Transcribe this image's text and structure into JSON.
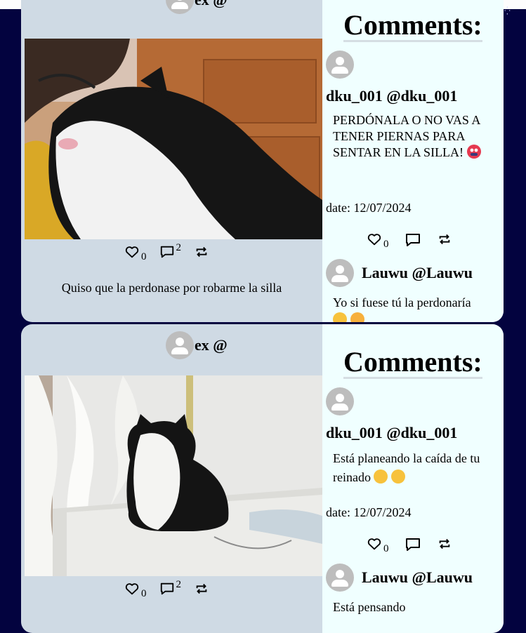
{
  "posts": [
    {
      "author": "ex @",
      "likes": "0",
      "comments_count": "2",
      "caption": "Quiso que la perdonase por robarme la silla",
      "comments_heading": "Comments:",
      "comments": [
        {
          "user": "dku_001 @dku_001",
          "text": "PERDÓNALA O NO VAS A TENER PIERNAS PARA SENTAR EN LA SILLA!",
          "emoji": "mask-mouth-emoji",
          "date": "date: 12/07/2024",
          "likes": "0"
        },
        {
          "user": "Lauwu @Lauwu",
          "text": "Yo si fuese tú la perdonaría",
          "emoji": "heart-eyes-emoji"
        }
      ]
    },
    {
      "author": "ex @",
      "likes": "0",
      "comments_count": "2",
      "comments_heading": "Comments:",
      "comments": [
        {
          "user": "dku_001 @dku_001",
          "text": "Está planeando la caída de tu reinado",
          "emoji": "laughing-tears-emoji",
          "date": "date: 12/07/2024",
          "likes": "0"
        },
        {
          "user": "Lauwu @Lauwu",
          "text": "Está pensando"
        }
      ]
    }
  ],
  "icons": [
    "heart-icon",
    "comment-icon",
    "repost-icon",
    "default-avatar-icon"
  ],
  "colors": {
    "background": "#03033f",
    "card": "#cfdae4",
    "comments_panel": "#f0ffff"
  }
}
